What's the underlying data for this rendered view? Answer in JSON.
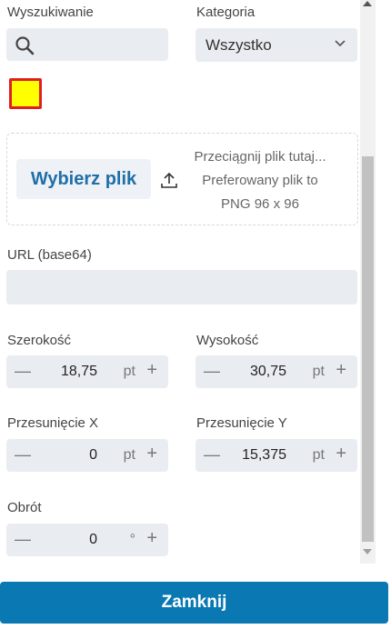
{
  "search": {
    "label": "Wyszukiwanie",
    "value": "",
    "placeholder": ""
  },
  "category": {
    "label": "Kategoria",
    "selected": "Wszystko"
  },
  "color_swatch": {
    "fill": "#ffff00",
    "border": "#e02020"
  },
  "upload": {
    "button_label": "Wybierz plik",
    "drop_hint": "Przeciągnij plik tutaj...",
    "preferred_line1": "Preferowany plik to",
    "preferred_line2": "PNG 96 x 96"
  },
  "url": {
    "label": "URL (base64)",
    "value": ""
  },
  "width": {
    "label": "Szerokość",
    "value": "18,75",
    "unit": "pt",
    "minus": "—",
    "plus": "+"
  },
  "height": {
    "label": "Wysokość",
    "value": "30,75",
    "unit": "pt",
    "minus": "—",
    "plus": "+"
  },
  "offset_x": {
    "label": "Przesunięcie X",
    "value": "0",
    "unit": "pt",
    "minus": "—",
    "plus": "+"
  },
  "offset_y": {
    "label": "Przesunięcie Y",
    "value": "15,375",
    "unit": "pt",
    "minus": "—",
    "plus": "+"
  },
  "rotation": {
    "label": "Obrót",
    "value": "0",
    "unit": "°",
    "minus": "—",
    "plus": "+"
  },
  "close_button": {
    "label": "Zamknij",
    "color": "#0a78b3"
  }
}
